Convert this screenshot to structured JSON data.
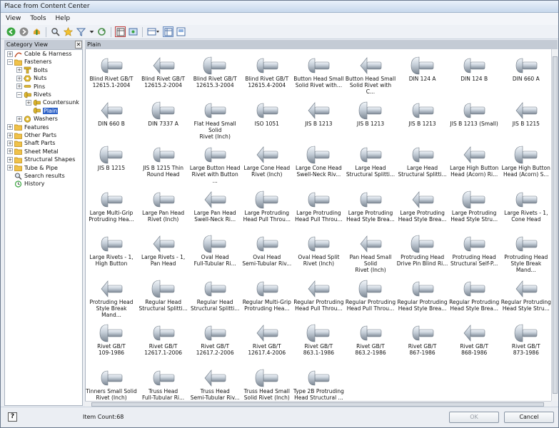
{
  "window": {
    "title": "Place from Content Center"
  },
  "menu": [
    "View",
    "Tools",
    "Help"
  ],
  "toolbar": {
    "icons": [
      "back-icon",
      "forward-icon",
      "up-icon",
      "search-icon",
      "favorite-icon",
      "filter-icon",
      "dropdown-icon",
      "refresh-icon",
      "table-view-icon",
      "view-mode-icon",
      "tree-view-icon",
      "list-view-icon"
    ]
  },
  "left_panel": {
    "header": "Category View",
    "tree": [
      {
        "label": "Cable & Harness",
        "level": 0,
        "expander": "+",
        "icon": "cable-icon"
      },
      {
        "label": "Fasteners",
        "level": 0,
        "expander": "-",
        "icon": "folder-icon"
      },
      {
        "label": "Bolts",
        "level": 1,
        "expander": "+",
        "icon": "bolt-icon"
      },
      {
        "label": "Nuts",
        "level": 1,
        "expander": "+",
        "icon": "nut-icon"
      },
      {
        "label": "Pins",
        "level": 1,
        "expander": "+",
        "icon": "pin-icon"
      },
      {
        "label": "Rivets",
        "level": 1,
        "expander": "-",
        "icon": "rivet-icon"
      },
      {
        "label": "Countersunk",
        "level": 2,
        "expander": "+",
        "icon": "rivet-icon"
      },
      {
        "label": "Plain",
        "level": 2,
        "expander": "",
        "icon": "rivet-icon",
        "selected": true
      },
      {
        "label": "Washers",
        "level": 1,
        "expander": "+",
        "icon": "washer-icon"
      },
      {
        "label": "Features",
        "level": 0,
        "expander": "+",
        "icon": "folder-icon"
      },
      {
        "label": "Other Parts",
        "level": 0,
        "expander": "+",
        "icon": "folder-icon"
      },
      {
        "label": "Shaft Parts",
        "level": 0,
        "expander": "+",
        "icon": "folder-icon"
      },
      {
        "label": "Sheet Metal",
        "level": 0,
        "expander": "+",
        "icon": "folder-icon"
      },
      {
        "label": "Structural Shapes",
        "level": 0,
        "expander": "+",
        "icon": "folder-icon"
      },
      {
        "label": "Tube & Pipe",
        "level": 0,
        "expander": "+",
        "icon": "folder-icon"
      },
      {
        "label": "Search results",
        "level": 0,
        "expander": "",
        "icon": "search-icon"
      },
      {
        "label": "History",
        "level": 0,
        "expander": "",
        "icon": "history-icon"
      }
    ]
  },
  "right_panel": {
    "header": "Plain",
    "items": [
      [
        "Blind Rivet GB/T",
        "12615.1-2004"
      ],
      [
        "Blind Rivet GB/T",
        "12615.2-2004"
      ],
      [
        "Blind Rivet GB/T",
        "12615.3-2004"
      ],
      [
        "Blind Rivet GB/T",
        "12615.4-2004"
      ],
      [
        "Button Head Small",
        "Solid Rivet with..."
      ],
      [
        "Button Head Small",
        "Solid Rivet with C..."
      ],
      [
        "DIN 124 A",
        ""
      ],
      [
        "DIN 124 B",
        ""
      ],
      [
        "DIN 660 A",
        ""
      ],
      [
        "DIN 660 B",
        ""
      ],
      [
        "DIN 7337 A",
        ""
      ],
      [
        "Flat Head Small Solid",
        "Rivet (Inch)"
      ],
      [
        "ISO 1051",
        ""
      ],
      [
        "JIS B 1213",
        ""
      ],
      [
        "JIS B 1213",
        ""
      ],
      [
        "JIS B 1213",
        ""
      ],
      [
        "JIS B 1213 (Small)",
        ""
      ],
      [
        "JIS B 1215",
        ""
      ],
      [
        "JIS B 1215",
        ""
      ],
      [
        "JIS B 1215 Thin",
        "Round Head"
      ],
      [
        "Large Button Head",
        "Rivet with Button ..."
      ],
      [
        "Large Cone Head",
        "Rivet (Inch)"
      ],
      [
        "Large Cone Head",
        "Swell-Neck Riv..."
      ],
      [
        "Large Head",
        "Structural Splitti..."
      ],
      [
        "Large Head",
        "Structural Splitti..."
      ],
      [
        "Large High Button",
        "Head (Acorn) Ri..."
      ],
      [
        "Large High Button",
        "Head (Acorn) S..."
      ],
      [
        "Large Multi-Grip",
        "Protruding Hea..."
      ],
      [
        "Large Pan Head",
        "Rivet (Inch)"
      ],
      [
        "Large Pan Head",
        "Swell-Neck Ri..."
      ],
      [
        "Large Protruding",
        "Head Pull Throu..."
      ],
      [
        "Large Protruding",
        "Head Pull Throu..."
      ],
      [
        "Large Protruding",
        "Head Style Brea..."
      ],
      [
        "Large Protruding",
        "Head Style Brea..."
      ],
      [
        "Large Protruding",
        "Head Style Stru..."
      ],
      [
        "Large Rivets - 1,",
        "Cone Head"
      ],
      [
        "Large Rivets - 1,",
        "High Button"
      ],
      [
        "Large Rivets - 1,",
        "Pan Head"
      ],
      [
        "Oval Head",
        "Full-Tubular Ri..."
      ],
      [
        "Oval Head",
        "Semi-Tubular Riv..."
      ],
      [
        "Oval Head Split",
        "Rivet (Inch)"
      ],
      [
        "Pan Head Small Solid",
        "Rivet (Inch)"
      ],
      [
        "Protruding Head",
        "Drive Pin Blind Ri..."
      ],
      [
        "Protruding Head",
        "Structural Self-P..."
      ],
      [
        "Protruding Head",
        "Style Break Mand..."
      ],
      [
        "Protruding Head",
        "Style Break Mand..."
      ],
      [
        "Regular Head",
        "Structural Splitti..."
      ],
      [
        "Regular Head",
        "Structural Splitti..."
      ],
      [
        "Regular Multi-Grip",
        "Protruding Hea..."
      ],
      [
        "Regular Protruding",
        "Head Pull Throu..."
      ],
      [
        "Regular Protruding",
        "Head Pull Throu..."
      ],
      [
        "Regular Protruding",
        "Head Style Brea..."
      ],
      [
        "Regular Protruding",
        "Head Style Brea..."
      ],
      [
        "Regular Protruding",
        "Head Style Stru..."
      ],
      [
        "Rivet GB/T",
        "109-1986"
      ],
      [
        "Rivet GB/T",
        "12617.1-2006"
      ],
      [
        "Rivet GB/T",
        "12617.2-2006"
      ],
      [
        "Rivet GB/T",
        "12617.4-2006"
      ],
      [
        "Rivet GB/T",
        "863.1-1986"
      ],
      [
        "Rivet GB/T",
        "863.2-1986"
      ],
      [
        "Rivet GB/T",
        "867-1986"
      ],
      [
        "Rivet GB/T",
        "868-1986"
      ],
      [
        "Rivet GB/T",
        "873-1986"
      ],
      [
        "Tinners Small Solid",
        "Rivet (Inch)"
      ],
      [
        "Truss Head",
        "Full-Tubular Ri..."
      ],
      [
        "Truss Head",
        "Semi-Tubular Riv..."
      ],
      [
        "Truss Head Small",
        "Solid Rivet (Inch)"
      ],
      [
        "Type 2B Protruding",
        "Head Structural ..."
      ]
    ]
  },
  "status": {
    "help_icon": "?",
    "item_count": "Item Count:68"
  },
  "buttons": {
    "ok": "OK",
    "cancel": "Cancel"
  }
}
